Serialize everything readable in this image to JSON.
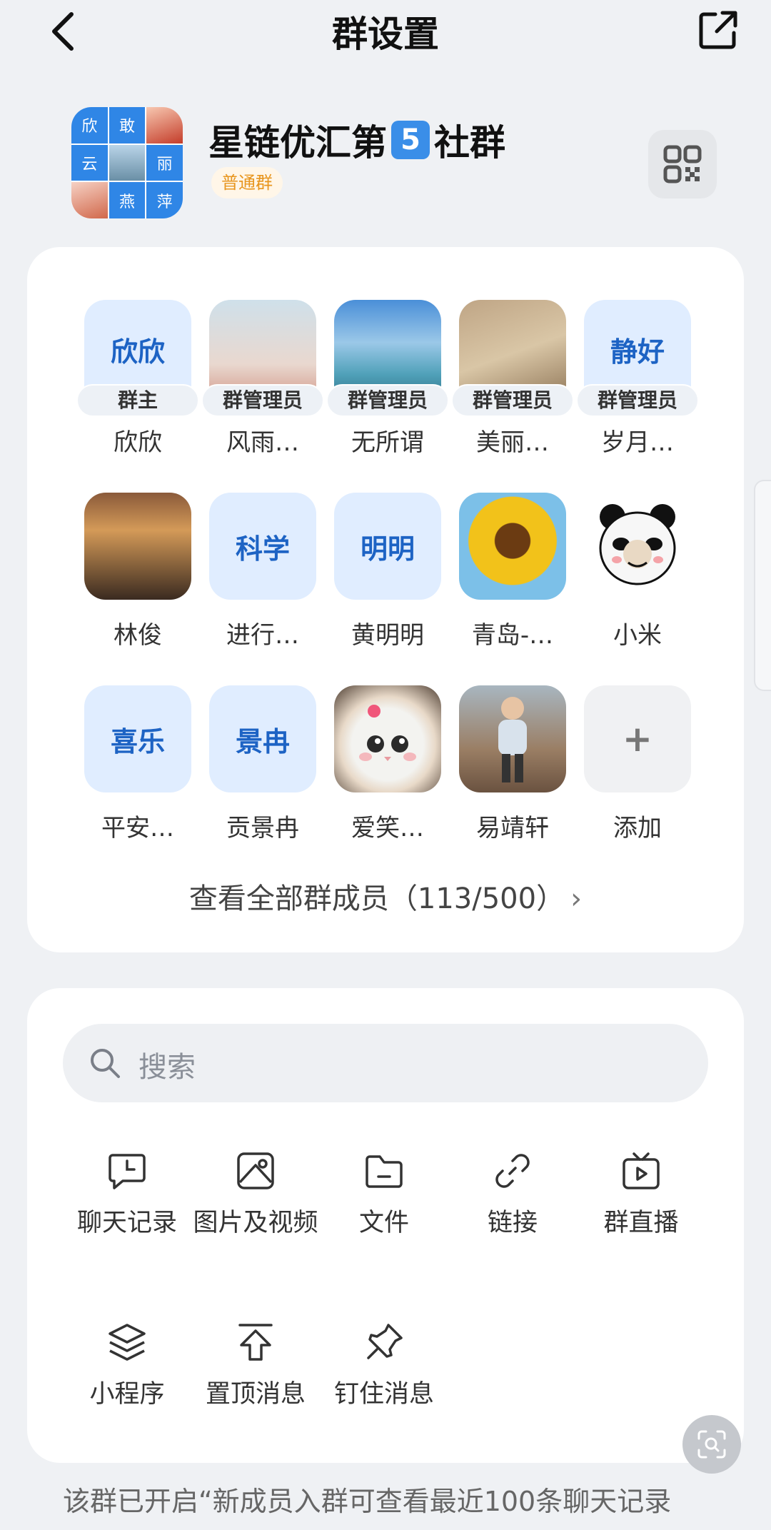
{
  "header": {
    "title": "群设置"
  },
  "group": {
    "avatar_cells": [
      "欣",
      "敢",
      "",
      "云",
      "",
      "丽",
      "",
      "燕",
      "萍"
    ],
    "name_prefix": "星链优汇第",
    "name_number": "5",
    "name_suffix": "社群",
    "tag": "普通群"
  },
  "members": [
    {
      "avatar_text": "欣欣",
      "role": "群主",
      "name": "欣欣"
    },
    {
      "avatar_text": "",
      "role": "群管理员",
      "name": "风雨…"
    },
    {
      "avatar_text": "",
      "role": "群管理员",
      "name": "无所谓"
    },
    {
      "avatar_text": "",
      "role": "群管理员",
      "name": "美丽…"
    },
    {
      "avatar_text": "静好",
      "role": "群管理员",
      "name": "岁月…"
    },
    {
      "avatar_text": "",
      "name": "林俊"
    },
    {
      "avatar_text": "科学",
      "name": "进行…"
    },
    {
      "avatar_text": "明明",
      "name": "黄明明"
    },
    {
      "avatar_text": "",
      "name": "青岛-…"
    },
    {
      "avatar_text": "",
      "name": "小米"
    },
    {
      "avatar_text": "喜乐",
      "name": "平安…"
    },
    {
      "avatar_text": "景冉",
      "name": "贡景冉"
    },
    {
      "avatar_text": "",
      "name": "爱笑…"
    },
    {
      "avatar_text": "",
      "name": "易靖轩"
    },
    {
      "avatar_text": "+",
      "name": "添加"
    }
  ],
  "view_all": "查看全部群成员（113/500）",
  "search": {
    "placeholder": "搜索"
  },
  "tools": [
    {
      "icon": "chat-history-icon",
      "label": "聊天记录"
    },
    {
      "icon": "image-video-icon",
      "label": "图片及视频"
    },
    {
      "icon": "file-icon",
      "label": "文件"
    },
    {
      "icon": "link-icon",
      "label": "链接"
    },
    {
      "icon": "live-icon",
      "label": "群直播"
    },
    {
      "icon": "mini-program-icon",
      "label": "小程序"
    },
    {
      "icon": "pinned-message-icon",
      "label": "置顶消息"
    },
    {
      "icon": "pin-icon",
      "label": "钉住消息"
    }
  ],
  "bottom_note": "该群已开启“新成员入群可查看最近100条聊天记录"
}
